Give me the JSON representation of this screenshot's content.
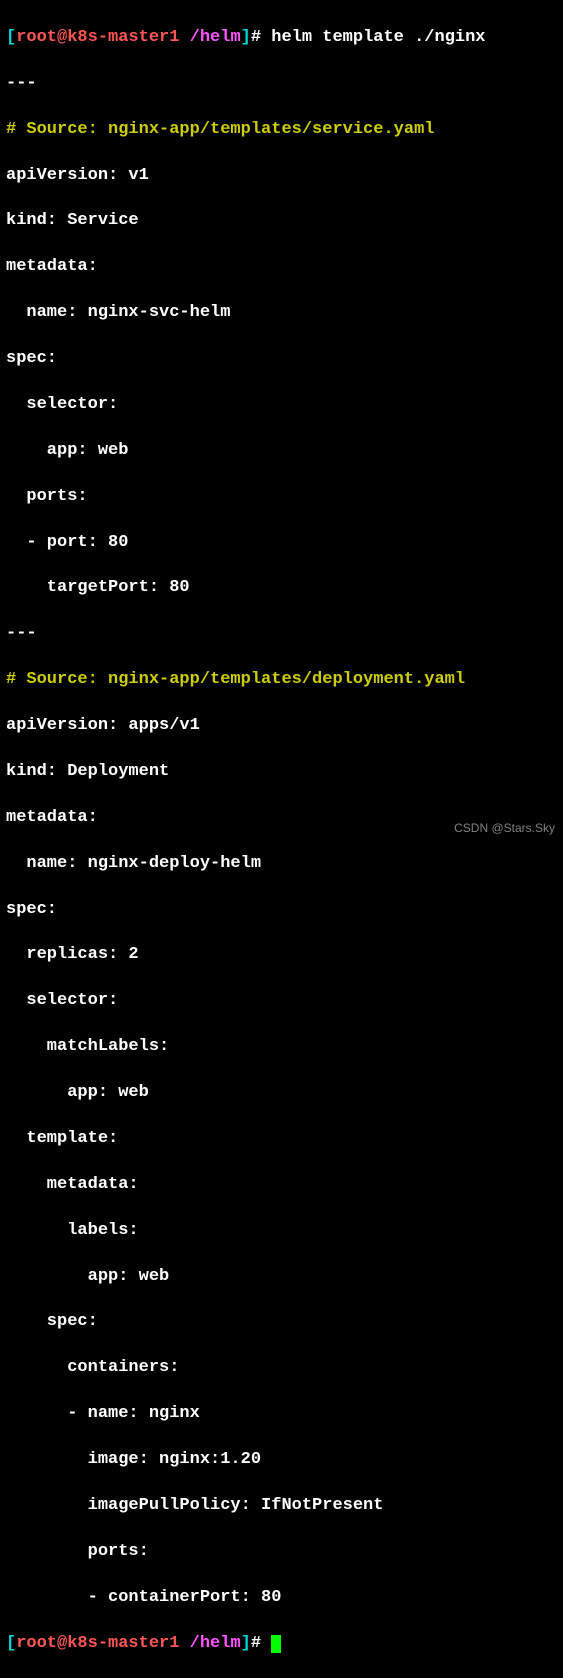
{
  "prompt1": {
    "userhost": "root@k8s-master1",
    "path": "/helm",
    "command": "helm template ./nginx"
  },
  "output": [
    "---",
    "# Source: nginx-app/templates/service.yaml",
    "apiVersion: v1",
    "kind: Service",
    "metadata:",
    "  name: nginx-svc-helm",
    "spec:",
    "  selector:",
    "    app: web",
    "  ports:",
    "  - port: 80",
    "    targetPort: 80",
    "---",
    "# Source: nginx-app/templates/deployment.yaml",
    "apiVersion: apps/v1",
    "kind: Deployment",
    "metadata:",
    "  name: nginx-deploy-helm",
    "spec:",
    "  replicas: 2",
    "  selector:",
    "    matchLabels:",
    "      app: web",
    "  template:",
    "    metadata:",
    "      labels:",
    "        app: web",
    "    spec:",
    "      containers:",
    "      - name: nginx",
    "        image: nginx:1.20",
    "        imagePullPolicy: IfNotPresent",
    "        ports:",
    "        - containerPort: 80"
  ],
  "prompt2": {
    "userhost": "root@k8s-master1",
    "path": "/helm"
  },
  "watermark": "CSDN @Stars.Sky"
}
